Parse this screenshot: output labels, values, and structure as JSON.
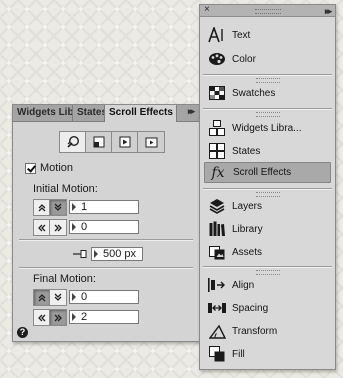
{
  "scroll_effects_panel": {
    "tabs": [
      {
        "label": "Widgets Libr"
      },
      {
        "label": "States"
      },
      {
        "label": "Scroll Effects"
      }
    ],
    "collapse_glyph": "▸▸",
    "mode_buttons": [
      "motion-icon",
      "graphic-icon",
      "slideshow-icon",
      "animation-icon"
    ],
    "motion_checkbox": {
      "label": "Motion",
      "checked": true
    },
    "initial_motion": {
      "label": "Initial Motion:",
      "vertical": {
        "value": "1",
        "pressed": "down"
      },
      "horizontal": {
        "value": "0",
        "pressed": "none"
      }
    },
    "key_position": {
      "value": "500 px"
    },
    "final_motion": {
      "label": "Final Motion:",
      "vertical": {
        "value": "0",
        "pressed": "up"
      },
      "horizontal": {
        "value": "2",
        "pressed": "right"
      }
    },
    "help_glyph": "?"
  },
  "tools_panel": {
    "close_glyph": "×",
    "collapse_glyph": "▸▸",
    "groups": [
      [
        {
          "label": "Text",
          "icon": "text-icon"
        },
        {
          "label": "Color",
          "icon": "palette-icon"
        }
      ],
      [
        {
          "label": "Swatches",
          "icon": "swatches-icon"
        }
      ],
      [
        {
          "label": "Widgets Libra...",
          "icon": "widgets-icon"
        },
        {
          "label": "States",
          "icon": "states-icon"
        },
        {
          "label": "Scroll Effects",
          "icon": "fx-icon",
          "selected": true
        }
      ],
      [
        {
          "label": "Layers",
          "icon": "layers-icon"
        },
        {
          "label": "Library",
          "icon": "library-icon"
        },
        {
          "label": "Assets",
          "icon": "assets-icon"
        }
      ],
      [
        {
          "label": "Align",
          "icon": "align-icon"
        },
        {
          "label": "Spacing",
          "icon": "spacing-icon"
        },
        {
          "label": "Transform",
          "icon": "transform-icon"
        },
        {
          "label": "Fill",
          "icon": "fill-icon"
        }
      ]
    ]
  }
}
